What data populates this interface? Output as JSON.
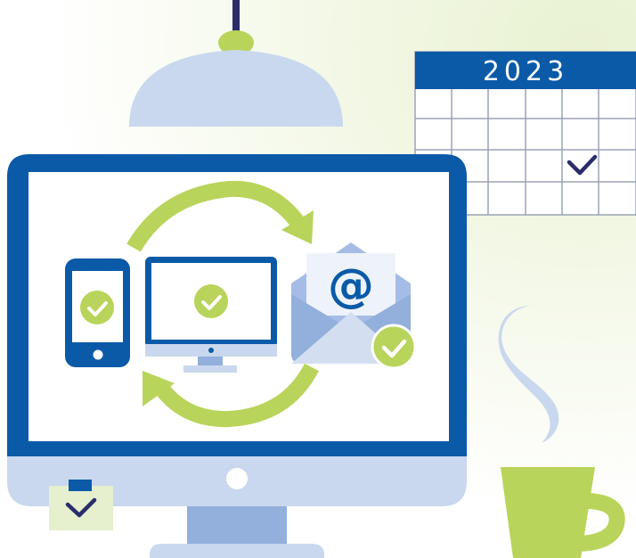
{
  "calendar": {
    "year": "2023",
    "checked_cell": "row 3, column 5"
  },
  "email": {
    "symbol": "@"
  },
  "colors": {
    "navy": "#0a5aa8",
    "dark_navy": "#2a2d6a",
    "lime": "#b8d45a",
    "light_blue": "#c9d8ee",
    "mid_blue": "#93afdc",
    "envelope_blue": "#a5bde6",
    "background_tint": "#eef5dc"
  },
  "icons": [
    "ceiling-lamp-icon",
    "calendar-icon",
    "monitor-icon",
    "smartphone-icon",
    "desktop-computer-icon",
    "email-envelope-icon",
    "sync-arrows-icon",
    "checkmark-icon",
    "steam-icon",
    "coffee-cup-icon",
    "sticky-note-icon"
  ]
}
